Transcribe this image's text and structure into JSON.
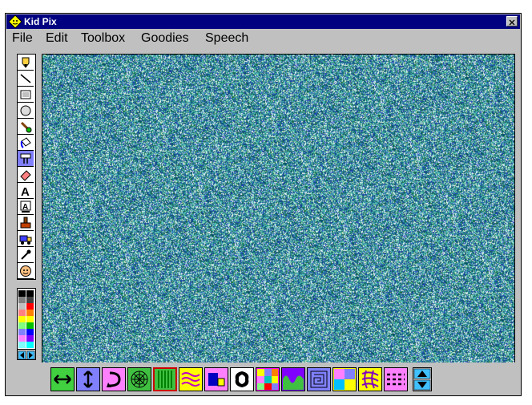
{
  "window": {
    "title": "Kid Pix"
  },
  "menu": {
    "items": [
      "File",
      "Edit",
      "Toolbox",
      "Goodies",
      "Speech"
    ]
  },
  "tools": [
    {
      "name": "pencil-tool-icon",
      "icon": "pencil"
    },
    {
      "name": "line-tool-icon",
      "icon": "line"
    },
    {
      "name": "rectangle-tool-icon",
      "icon": "rectangle"
    },
    {
      "name": "oval-tool-icon",
      "icon": "oval"
    },
    {
      "name": "wacky-brush-tool-icon",
      "icon": "brush"
    },
    {
      "name": "paint-can-tool-icon",
      "icon": "paint-can"
    },
    {
      "name": "electric-mixer-tool-icon",
      "icon": "mixer"
    },
    {
      "name": "eraser-tool-icon",
      "icon": "eraser"
    },
    {
      "name": "text-tool-icon",
      "icon": "letter-a"
    },
    {
      "name": "alphabet-stamp-tool-icon",
      "icon": "letter-a-box"
    },
    {
      "name": "rubber-stamp-tool-icon",
      "icon": "stamp"
    },
    {
      "name": "moving-van-tool-icon",
      "icon": "truck"
    },
    {
      "name": "eyedropper-tool-icon",
      "icon": "eyedropper"
    },
    {
      "name": "undo-guy-tool-icon",
      "icon": "face"
    }
  ],
  "selected_tool": "electric-mixer-tool-icon",
  "palette": {
    "left_column": [
      "#000000",
      "#808080",
      "#c0c0c0",
      "#ff8080",
      "#ffff00",
      "#80ff80",
      "#8080ff",
      "#ff80ff",
      "#80ffff"
    ],
    "right_column": [
      "#000000",
      "#404040",
      "#ff0000",
      "#ff8000",
      "#ffff00",
      "#00c000",
      "#0000ff",
      "#8000ff",
      "#00ffff"
    ]
  },
  "colors": {
    "title_bar": "#000080",
    "window_face": "#c0c0c0",
    "canvas_base": "#2c8a8f",
    "selection_outline": "#cc0000"
  },
  "tool_options": [
    {
      "name": "option-flip-horizontal-icon",
      "bg": "#40d040"
    },
    {
      "name": "option-flip-vertical-icon",
      "bg": "#8080ff"
    },
    {
      "name": "option-rotate-icon",
      "bg": "#ff80ff"
    },
    {
      "name": "option-web-icon",
      "bg": "#40c040"
    },
    {
      "name": "option-stripes-icon",
      "bg": "#40c040",
      "selected": true
    },
    {
      "name": "option-waves-icon",
      "bg": "#ffff00"
    },
    {
      "name": "option-shape-square-icon",
      "bg": "#ff80ff"
    },
    {
      "name": "option-butterfly-pattern-icon",
      "bg": "#ffffff"
    },
    {
      "name": "option-checker-pattern-icon",
      "bg": "#ff00ff"
    },
    {
      "name": "option-wave-fill-icon",
      "bg": "#8000ff"
    },
    {
      "name": "option-maze-pattern-icon",
      "bg": "#8080ff"
    },
    {
      "name": "option-color-blocks-icon",
      "bg": "#ffff00"
    },
    {
      "name": "option-grid-scramble-icon",
      "bg": "#ffff00"
    },
    {
      "name": "option-dashed-lines-icon",
      "bg": "#ff80ff"
    }
  ]
}
